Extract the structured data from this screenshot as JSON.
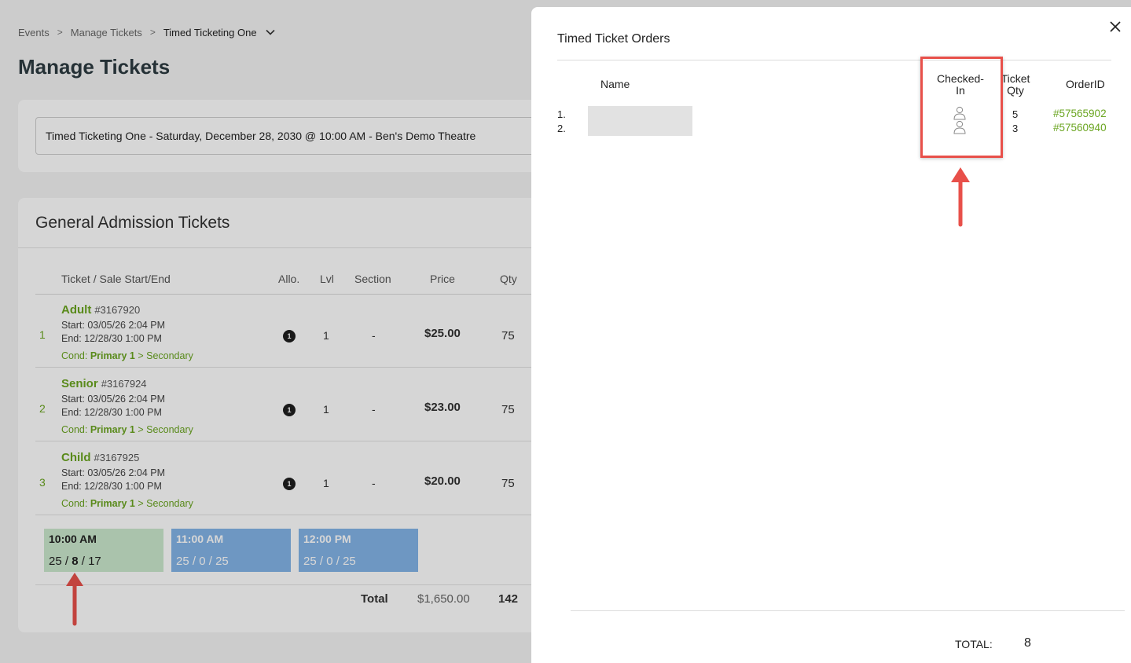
{
  "breadcrumb": {
    "item1": "Events",
    "item2": "Manage Tickets",
    "current": "Timed Ticketing One"
  },
  "page_title": "Manage Tickets",
  "event_select": {
    "value": "Timed Ticketing One - Saturday, December 28, 2030 @ 10:00 AM - Ben's Demo Theatre"
  },
  "tickets_card": {
    "title": "General Admission Tickets",
    "headers": {
      "ticket": "Ticket / Sale Start/End",
      "allo": "Allo.",
      "lvl": "Lvl",
      "section": "Section",
      "price": "Price",
      "qty": "Qty"
    },
    "rows": [
      {
        "num": "1",
        "name": "Adult",
        "id": "#3167920",
        "start": "Start: 03/05/26 2:04 PM",
        "end": "End: 12/28/30 1:00 PM",
        "cond_prefix": "Cond:",
        "cond_primary": "Primary 1",
        "cond_sep": ">",
        "cond_secondary": "Secondary",
        "allo": "1",
        "lvl": "1",
        "section": "-",
        "price": "$25.00",
        "qty": "75"
      },
      {
        "num": "2",
        "name": "Senior",
        "id": "#3167924",
        "start": "Start: 03/05/26 2:04 PM",
        "end": "End: 12/28/30 1:00 PM",
        "cond_prefix": "Cond:",
        "cond_primary": "Primary 1",
        "cond_sep": ">",
        "cond_secondary": "Secondary",
        "allo": "1",
        "lvl": "1",
        "section": "-",
        "price": "$23.00",
        "qty": "75"
      },
      {
        "num": "3",
        "name": "Child",
        "id": "#3167925",
        "start": "Start: 03/05/26 2:04 PM",
        "end": "End: 12/28/30 1:00 PM",
        "cond_prefix": "Cond:",
        "cond_primary": "Primary 1",
        "cond_sep": ">",
        "cond_secondary": "Secondary",
        "allo": "1",
        "lvl": "1",
        "section": "-",
        "price": "$20.00",
        "qty": "75"
      }
    ],
    "time_slots": [
      {
        "time": "10:00 AM",
        "a": "25",
        "b": "8",
        "c": "17",
        "color": "#cbe9cd"
      },
      {
        "time": "11:00 AM",
        "a": "25",
        "b": "0",
        "c": "25",
        "color": "#84b4e8"
      },
      {
        "time": "12:00 PM",
        "a": "25",
        "b": "0",
        "c": "25",
        "color": "#84b4e8"
      }
    ],
    "totals": {
      "label": "Total",
      "price": "$1,650.00",
      "qty": "142"
    }
  },
  "modal": {
    "title": "Timed Ticket Orders",
    "headers": {
      "name": "Name",
      "checked_in_1": "Checked-",
      "checked_in_2": "In",
      "ticket_qty_1": "Ticket",
      "ticket_qty_2": "Qty",
      "order_id": "OrderID"
    },
    "orders": [
      {
        "num": "1.",
        "qty": "5",
        "order_id": "#57565902"
      },
      {
        "num": "2.",
        "qty": "3",
        "order_id": "#57560940"
      }
    ],
    "total_label": "TOTAL:",
    "total_value": "8"
  },
  "colors": {
    "accent_green": "#6aa520",
    "annotation_red": "#e8504a",
    "slot_green": "#cbe9cd",
    "slot_blue": "#84b4e8"
  },
  "icons": [
    "chevron-down-icon",
    "close-icon",
    "person-icon",
    "arrow-up-icon"
  ]
}
